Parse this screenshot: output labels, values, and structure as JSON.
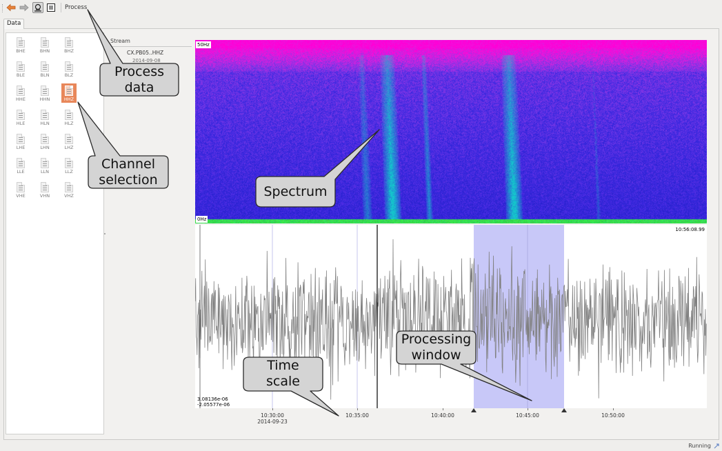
{
  "toolbar": {
    "back_icon": "back-arrow-icon",
    "forward_icon": "forward-arrow-icon",
    "toggle_icon": "zoom-scope-icon",
    "menu_icon": "list-menu-icon",
    "process_label": "Process"
  },
  "tabs": [
    {
      "label": "Data",
      "active": true
    }
  ],
  "channels": [
    [
      "BHE",
      "BHN",
      "BHZ"
    ],
    [
      "BLE",
      "BLN",
      "BLZ"
    ],
    [
      "HHE",
      "HHN",
      "HHZ"
    ],
    [
      "HLE",
      "HLN",
      "HLZ"
    ],
    [
      "LHE",
      "LHN",
      "LHZ"
    ],
    [
      "LLE",
      "LLN",
      "LLZ"
    ],
    [
      "VHE",
      "VHN",
      "VHZ"
    ]
  ],
  "selected_channel": "HHZ",
  "stream_panel": {
    "header": "Stream",
    "stream_name": "CX.PB05..HHZ",
    "stream_date": "2014-09-08"
  },
  "spectrogram": {
    "freq_top": "50Hz",
    "freq_bottom": "0Hz"
  },
  "seismogram": {
    "end_time_label": "10:56:08.99",
    "amp_max": "3.08136e-06",
    "amp_min": "-2.05577e-06",
    "color": "#808080"
  },
  "time_axis": {
    "ticks": [
      "10:30:00",
      "10:35:00",
      "10:40:00",
      "10:45:00",
      "10:50:00"
    ],
    "date": "2014-09-23"
  },
  "callouts": {
    "process_data": "Process\ndata",
    "channel_selection": "Channel\nselection",
    "spectrum": "Spectrum",
    "time_scale": "Time\nscale",
    "processing_window": "Processing\nwindow"
  },
  "status": {
    "text": "Running",
    "icon": "running-indicator-icon"
  },
  "colors": {
    "selection_window": "#c8c8f8",
    "selected_channel": "#e8875a",
    "spectrogram_high": "#e822d8",
    "spectrogram_mid": "#4a28e0",
    "spectrogram_signal": "#18c8c0"
  }
}
